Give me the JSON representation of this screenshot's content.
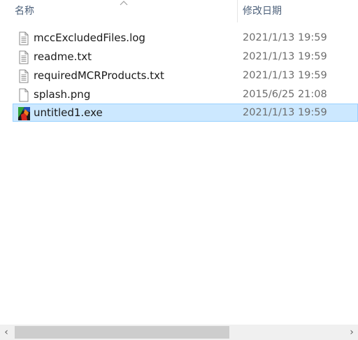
{
  "columns": {
    "name": "名称",
    "date_modified": "修改日期"
  },
  "files": [
    {
      "name": "mccExcludedFiles.log",
      "date": "2021/1/13 19:59",
      "icon": "text-file-icon",
      "selected": false
    },
    {
      "name": "readme.txt",
      "date": "2021/1/13 19:59",
      "icon": "text-file-icon",
      "selected": false
    },
    {
      "name": "requiredMCRProducts.txt",
      "date": "2021/1/13 19:59",
      "icon": "text-file-icon",
      "selected": false
    },
    {
      "name": "splash.png",
      "date": "2015/6/25 21:08",
      "icon": "blank-file-icon",
      "selected": false
    },
    {
      "name": "untitled1.exe",
      "date": "2021/1/13 19:59",
      "icon": "matlab-exe-icon",
      "selected": true
    }
  ],
  "scrollbar": {
    "left_arrow": "‹",
    "right_arrow": "›"
  },
  "colors": {
    "selection_bg": "#cce8ff",
    "selection_border": "#99d1ff",
    "header_text": "#4c607a",
    "date_text": "#6d6d6d"
  }
}
